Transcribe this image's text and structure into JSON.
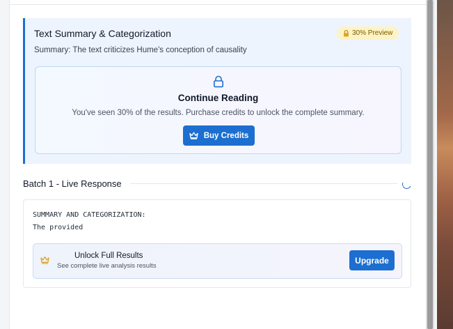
{
  "summary": {
    "title": "Text Summary & Categorization",
    "badge": "30% Preview",
    "text": "Summary: The text criticizes Hume's conception of causality"
  },
  "lock": {
    "title": "Continue Reading",
    "subtitle": "You've seen 30% of the results. Purchase credits to unlock the complete summary.",
    "button": "Buy Credits"
  },
  "batch": {
    "header": "Batch 1 - Live Response"
  },
  "response": {
    "line1": "SUMMARY AND CATEGORIZATION:",
    "line2": "The provided"
  },
  "unlock": {
    "title": "Unlock Full Results",
    "subtitle": "See complete live analysis results",
    "button": "Upgrade"
  },
  "colors": {
    "accent": "#1c6fd0",
    "badge_bg": "#fdf3c4",
    "card_bg": "#eef4fd"
  },
  "icons": [
    "lock-icon",
    "crown-icon",
    "crown-icon",
    "padlock-emoji-icon",
    "spinner-icon"
  ]
}
